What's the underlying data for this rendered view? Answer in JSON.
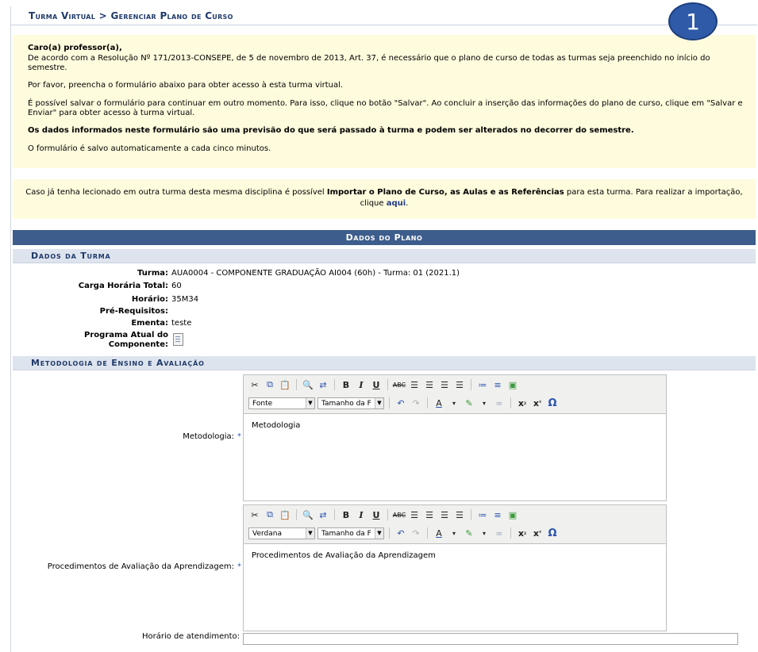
{
  "breadcrumb": "Turma Virtual > Gerenciar Plano de Curso",
  "step_badge": "1",
  "notice": {
    "greeting": "Caro(a) professor(a),",
    "line1": "De acordo com a Resolução Nº 171/2013-CONSEPE, de 5 de novembro de 2013, Art. 37, é necessário que o plano de curso de todas as turmas seja preenchido no início do semestre.",
    "line2": "Por favor, preencha o formulário abaixo para obter acesso à esta turma virtual.",
    "line3": "É possível salvar o formulário para continuar em outro momento. Para isso, clique no botão \"Salvar\". Ao concluir a inserção das informações do plano de curso, clique em \"Salvar e Enviar\" para obter acesso à turma virtual.",
    "line4": "Os dados informados neste formulário são uma previsão do que será passado à turma e podem ser alterados no decorrer do semestre.",
    "line5": "O formulário é salvo automaticamente a cada cinco minutos."
  },
  "import_notice": {
    "prefix": "Caso já tenha lecionado em outra turma desta mesma disciplina é possível ",
    "bold": "Importar o Plano de Curso, as Aulas e as Referências",
    "middle": " para esta turma. Para realizar a importação, clique ",
    "link": "aqui",
    "suffix": "."
  },
  "plan_header": "Dados do Plano",
  "section_turma": "Dados da Turma",
  "turma": {
    "turma_label": "Turma:",
    "turma_value": "AUA0004 - COMPONENTE GRADUAÇÃO AI004 (60h) - Turma: 01 (2021.1)",
    "carga_label": "Carga Horária Total:",
    "carga_value": "60",
    "horario_label": "Horário:",
    "horario_value": "35M34",
    "prereq_label": "Pré-Requisitos:",
    "ementa_label": "Ementa:",
    "ementa_value": "teste",
    "programa_label_1": "Programa Atual do",
    "programa_label_2": "Componente:"
  },
  "section_metodologia": "Metodologia de Ensino e Avaliação",
  "fields": {
    "metodologia_label": "Metodologia:",
    "procedimentos_label": "Procedimentos de Avaliação da Aprendizagem:",
    "horario_atendimento_label": "Horário de atendimento:",
    "required_mark": "*"
  },
  "editor1": {
    "font": "Fonte",
    "size": "Tamanho da F",
    "content": "Metodologia"
  },
  "editor2": {
    "font": "Verdana",
    "size": "Tamanho da F",
    "content": "Procedimentos de Avaliação da Aprendizagem"
  },
  "toolbar_icons": [
    "cut-icon",
    "copy-icon",
    "paste-icon",
    "find-icon",
    "replace-icon",
    "bold-icon",
    "italic-icon",
    "underline-icon",
    "strikethrough-icon",
    "align-left-icon",
    "align-center-icon",
    "align-right-icon",
    "justify-icon",
    "bullet-list-icon",
    "numbered-list-icon",
    "image-icon",
    "undo-icon",
    "redo-icon",
    "font-color-icon",
    "highlight-icon",
    "link-icon",
    "subscript-icon",
    "superscript-icon",
    "special-char-icon"
  ]
}
